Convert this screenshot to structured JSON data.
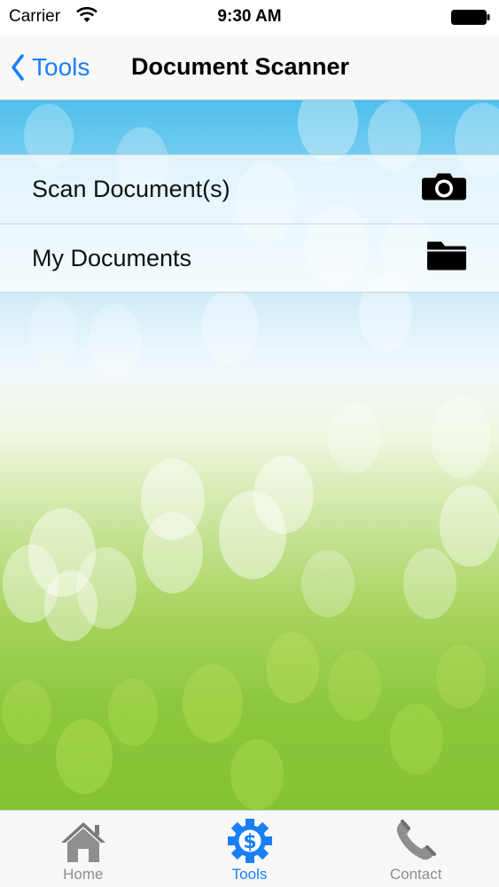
{
  "status_bar": {
    "carrier": "Carrier",
    "time": "9:30 AM"
  },
  "nav": {
    "back_label": "Tools",
    "title": "Document Scanner"
  },
  "list": {
    "items": [
      {
        "label": "Scan Document(s)",
        "icon": "camera-icon"
      },
      {
        "label": "My Documents",
        "icon": "folder-icon"
      }
    ]
  },
  "tab_bar": {
    "tabs": [
      {
        "label": "Home",
        "icon": "home-icon",
        "active": false
      },
      {
        "label": "Tools",
        "icon": "gear-dollar-icon",
        "active": true
      },
      {
        "label": "Contact",
        "icon": "phone-icon",
        "active": false
      }
    ]
  },
  "colors": {
    "accent": "#1a7ff5",
    "inactive": "#8e8e8e"
  }
}
